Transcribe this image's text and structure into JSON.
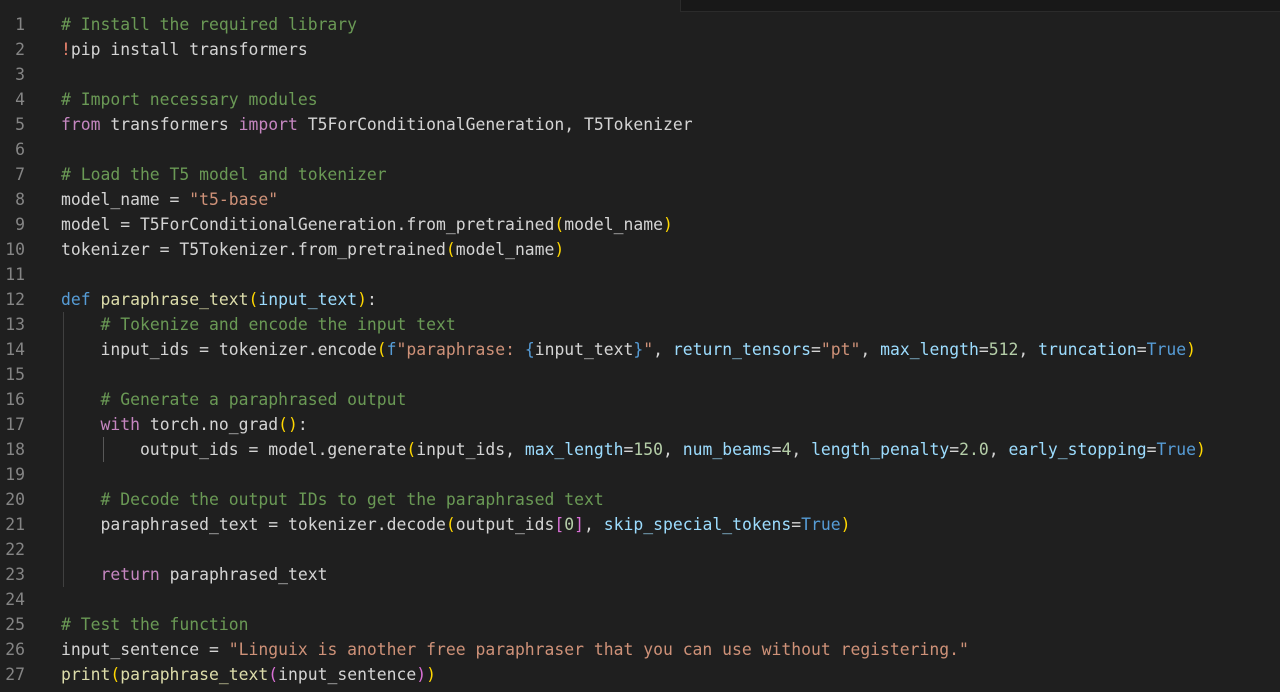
{
  "editor": {
    "language": "python",
    "colors": {
      "background": "#1f1f1f",
      "line_number": "#858585",
      "comment": "#6a9955",
      "keyword": "#569cd6",
      "control_keyword": "#c586c0",
      "function": "#dcdcaa",
      "string": "#ce9178",
      "number": "#b5cea8",
      "parameter": "#9cdcfe",
      "bracket_level_1": "#ffd700",
      "bracket_level_2": "#da70d6",
      "bracket_level_3": "#179fff"
    },
    "line_numbers": [
      "1",
      "2",
      "3",
      "4",
      "5",
      "6",
      "7",
      "8",
      "9",
      "10",
      "11",
      "12",
      "13",
      "14",
      "15",
      "16",
      "17",
      "18",
      "19",
      "20",
      "21",
      "22",
      "23",
      "24",
      "25",
      "26",
      "27"
    ],
    "lines": [
      [
        {
          "t": "c",
          "v": "# Install the required library"
        }
      ],
      [
        {
          "t": "bang",
          "v": "!"
        },
        {
          "t": "p",
          "v": "pip install transformers"
        }
      ],
      [],
      [
        {
          "t": "c",
          "v": "# Import necessary modules"
        }
      ],
      [
        {
          "t": "kf",
          "v": "from"
        },
        {
          "t": "p",
          "v": " transformers "
        },
        {
          "t": "kf",
          "v": "import"
        },
        {
          "t": "p",
          "v": " T5ForConditionalGeneration, T5Tokenizer"
        }
      ],
      [],
      [
        {
          "t": "c",
          "v": "# Load the T5 model and tokenizer"
        }
      ],
      [
        {
          "t": "p",
          "v": "model_name = "
        },
        {
          "t": "st",
          "v": "\"t5-base\""
        }
      ],
      [
        {
          "t": "p",
          "v": "model = T5ForConditionalGeneration.from_pretrained"
        },
        {
          "t": "br1",
          "v": "("
        },
        {
          "t": "p",
          "v": "model_name"
        },
        {
          "t": "br1",
          "v": ")"
        }
      ],
      [
        {
          "t": "p",
          "v": "tokenizer = T5Tokenizer.from_pretrained"
        },
        {
          "t": "br1",
          "v": "("
        },
        {
          "t": "p",
          "v": "model_name"
        },
        {
          "t": "br1",
          "v": ")"
        }
      ],
      [],
      [
        {
          "t": "kw",
          "v": "def"
        },
        {
          "t": "p",
          "v": " "
        },
        {
          "t": "fn",
          "v": "paraphrase_text"
        },
        {
          "t": "br1",
          "v": "("
        },
        {
          "t": "pm",
          "v": "input_text"
        },
        {
          "t": "br1",
          "v": ")"
        },
        {
          "t": "p",
          "v": ":"
        }
      ],
      [
        {
          "t": "p",
          "v": "    "
        },
        {
          "t": "c",
          "v": "# Tokenize and encode the input text"
        }
      ],
      [
        {
          "t": "p",
          "v": "    input_ids = tokenizer.encode"
        },
        {
          "t": "br1",
          "v": "("
        },
        {
          "t": "kw",
          "v": "f"
        },
        {
          "t": "st",
          "v": "\"paraphrase: "
        },
        {
          "t": "kw",
          "v": "{"
        },
        {
          "t": "p",
          "v": "input_text"
        },
        {
          "t": "kw",
          "v": "}"
        },
        {
          "t": "st",
          "v": "\""
        },
        {
          "t": "p",
          "v": ", "
        },
        {
          "t": "pm",
          "v": "return_tensors"
        },
        {
          "t": "p",
          "v": "="
        },
        {
          "t": "st",
          "v": "\"pt\""
        },
        {
          "t": "p",
          "v": ", "
        },
        {
          "t": "pm",
          "v": "max_length"
        },
        {
          "t": "p",
          "v": "="
        },
        {
          "t": "nm",
          "v": "512"
        },
        {
          "t": "p",
          "v": ", "
        },
        {
          "t": "pm",
          "v": "truncation"
        },
        {
          "t": "p",
          "v": "="
        },
        {
          "t": "kw",
          "v": "True"
        },
        {
          "t": "br1",
          "v": ")"
        }
      ],
      [],
      [
        {
          "t": "p",
          "v": "    "
        },
        {
          "t": "c",
          "v": "# Generate a paraphrased output"
        }
      ],
      [
        {
          "t": "p",
          "v": "    "
        },
        {
          "t": "kf",
          "v": "with"
        },
        {
          "t": "p",
          "v": " torch.no_grad"
        },
        {
          "t": "br1",
          "v": "()"
        },
        {
          "t": "p",
          "v": ":"
        }
      ],
      [
        {
          "t": "p",
          "v": "        output_ids = model.generate"
        },
        {
          "t": "br1",
          "v": "("
        },
        {
          "t": "p",
          "v": "input_ids, "
        },
        {
          "t": "pm",
          "v": "max_length"
        },
        {
          "t": "p",
          "v": "="
        },
        {
          "t": "nm",
          "v": "150"
        },
        {
          "t": "p",
          "v": ", "
        },
        {
          "t": "pm",
          "v": "num_beams"
        },
        {
          "t": "p",
          "v": "="
        },
        {
          "t": "nm",
          "v": "4"
        },
        {
          "t": "p",
          "v": ", "
        },
        {
          "t": "pm",
          "v": "length_penalty"
        },
        {
          "t": "p",
          "v": "="
        },
        {
          "t": "nm",
          "v": "2.0"
        },
        {
          "t": "p",
          "v": ", "
        },
        {
          "t": "pm",
          "v": "early_stopping"
        },
        {
          "t": "p",
          "v": "="
        },
        {
          "t": "kw",
          "v": "True"
        },
        {
          "t": "br1",
          "v": ")"
        }
      ],
      [],
      [
        {
          "t": "p",
          "v": "    "
        },
        {
          "t": "c",
          "v": "# Decode the output IDs to get the paraphrased text"
        }
      ],
      [
        {
          "t": "p",
          "v": "    paraphrased_text = tokenizer.decode"
        },
        {
          "t": "br1",
          "v": "("
        },
        {
          "t": "p",
          "v": "output_ids"
        },
        {
          "t": "br2",
          "v": "["
        },
        {
          "t": "nm",
          "v": "0"
        },
        {
          "t": "br2",
          "v": "]"
        },
        {
          "t": "p",
          "v": ", "
        },
        {
          "t": "pm",
          "v": "skip_special_tokens"
        },
        {
          "t": "p",
          "v": "="
        },
        {
          "t": "kw",
          "v": "True"
        },
        {
          "t": "br1",
          "v": ")"
        }
      ],
      [],
      [
        {
          "t": "p",
          "v": "    "
        },
        {
          "t": "kf",
          "v": "return"
        },
        {
          "t": "p",
          "v": " paraphrased_text"
        }
      ],
      [],
      [
        {
          "t": "c",
          "v": "# Test the function"
        }
      ],
      [
        {
          "t": "p",
          "v": "input_sentence = "
        },
        {
          "t": "st",
          "v": "\"Linguix is another free paraphraser that you can use without registering.\""
        }
      ],
      [
        {
          "t": "fn",
          "v": "print"
        },
        {
          "t": "br1",
          "v": "("
        },
        {
          "t": "fn",
          "v": "paraphrase_text"
        },
        {
          "t": "br2",
          "v": "("
        },
        {
          "t": "p",
          "v": "input_sentence"
        },
        {
          "t": "br2",
          "v": ")"
        },
        {
          "t": "br1",
          "v": ")"
        }
      ]
    ]
  }
}
